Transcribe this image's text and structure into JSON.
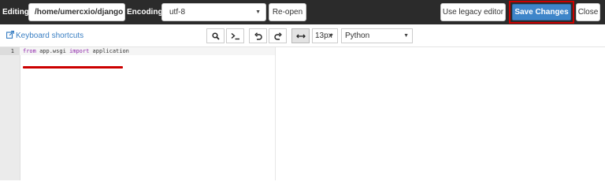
{
  "topbar": {
    "editing_label": "Editing:",
    "path_value": "/home/umercxio/django",
    "encoding_label": "Encoding:",
    "encoding_value": "utf-8",
    "reopen_label": "Re-open",
    "legacy_label": "Use legacy editor",
    "save_label": "Save Changes",
    "close_label": "Close"
  },
  "toolbar": {
    "shortcuts_label": "Keyboard shortcuts",
    "font_size": "13px",
    "language": "Python",
    "icons": [
      "search-icon",
      "terminal-icon",
      "undo-icon",
      "redo-icon",
      "wrap-icon"
    ]
  },
  "editor": {
    "line_numbers": [
      "1"
    ],
    "code": {
      "kw_from": "from",
      "module": " app.wsgi ",
      "kw_import": "import",
      "name": " application"
    }
  },
  "colors": {
    "accent": "#3e85c9",
    "highlight": "#cc0000",
    "topbar_bg": "#2b2b2b"
  }
}
